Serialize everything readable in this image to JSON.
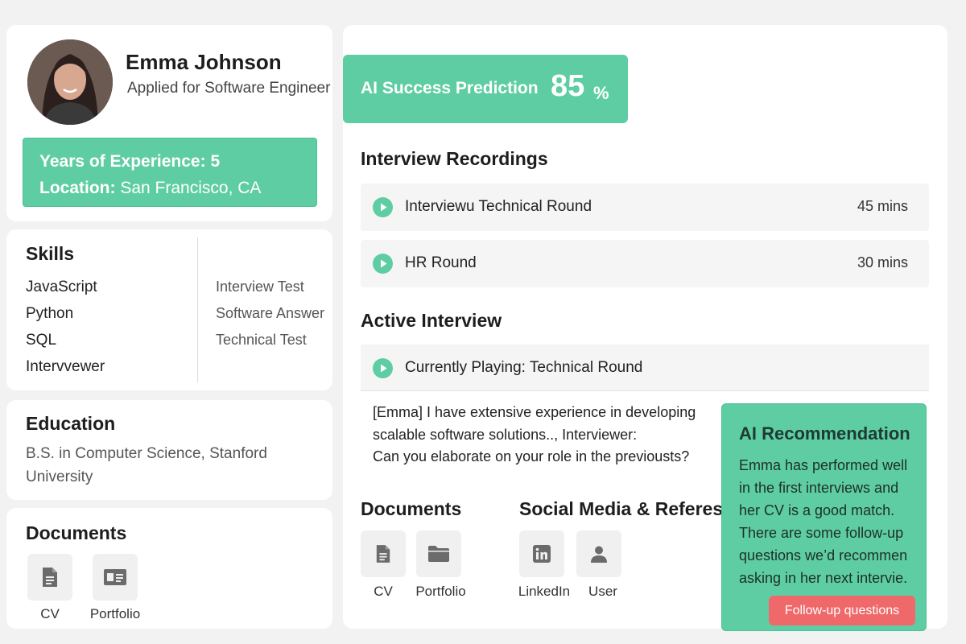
{
  "candidate": {
    "name": "Emma Johnson",
    "applied": "Applied for Software Engineer",
    "experience_label": "Years of Experience:",
    "experience_value": "5",
    "location_label": "Location:",
    "location_value": "San Francisco, CA"
  },
  "skills": {
    "title": "Skills",
    "items": [
      "JavaScript",
      "Python",
      "SQL",
      "Intervvewer"
    ],
    "tests": [
      "Interview Test",
      "Software Answer",
      "Technical Test"
    ]
  },
  "education": {
    "title": "Education",
    "text": "B.S. in Computer Science, Stanford University"
  },
  "documents_left": {
    "title": "Documents",
    "items": [
      {
        "label": "CV",
        "icon": "document-icon"
      },
      {
        "label": "Portfolio",
        "icon": "id-card-icon"
      }
    ]
  },
  "prediction": {
    "label": "AI Success Prediction",
    "value": "85",
    "unit": "%"
  },
  "recordings": {
    "title": "Interview Recordings",
    "items": [
      {
        "title": "Interviewu Technical Round",
        "duration": "45 mins"
      },
      {
        "title": "HR Round",
        "duration": "30 mins"
      }
    ]
  },
  "active_interview": {
    "title": "Active Interview",
    "now_playing": "Currently Playing: Technical Round",
    "transcript": [
      "[Emma] I have extensive experience in developing",
      "scalable software solutions.., Interviewer:",
      "Can you elaborate on your role in the previousts?"
    ]
  },
  "documents_main": {
    "title": "Documents",
    "items": [
      {
        "label": "CV",
        "icon": "document-icon"
      },
      {
        "label": "Portfolio",
        "icon": "folder-icon"
      }
    ]
  },
  "social": {
    "title": "Social Media & Referes",
    "items": [
      {
        "label": "LinkedIn",
        "icon": "linkedin-icon"
      },
      {
        "label": "User",
        "icon": "user-icon"
      }
    ]
  },
  "ai_recommendation": {
    "title": "AI Recommendation",
    "lines": [
      "Emma has performed well",
      "in the first interviews and",
      "her CV is a good match.",
      "There are some follow-up",
      "questions we’d recommen",
      "asking in her next intervie."
    ],
    "button": "Follow-up questions"
  },
  "colors": {
    "accent": "#5fcda4",
    "danger_button": "#f0696a",
    "play_icon": "#5fcda4"
  }
}
